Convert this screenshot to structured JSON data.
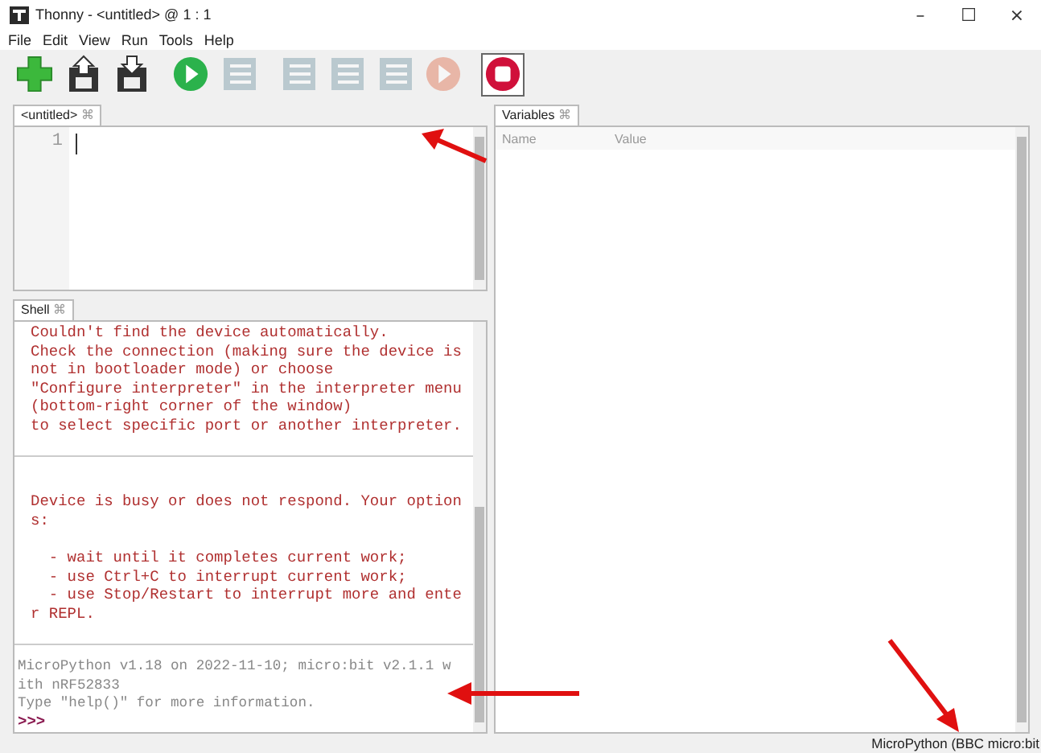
{
  "window": {
    "title": "Thonny  -  <untitled>  @  1 : 1",
    "controls": [
      "–",
      "☐",
      "×"
    ]
  },
  "menu": [
    "File",
    "Edit",
    "View",
    "Run",
    "Tools",
    "Help"
  ],
  "toolbar": [
    {
      "kind": "new",
      "disabled": false,
      "selected": false
    },
    {
      "kind": "load",
      "disabled": false,
      "selected": false
    },
    {
      "kind": "save",
      "disabled": false,
      "selected": false
    },
    {
      "kind": "run",
      "disabled": false,
      "selected": false
    },
    {
      "kind": "debug",
      "disabled": true,
      "selected": false
    },
    {
      "kind": "step-over",
      "disabled": true,
      "selected": false
    },
    {
      "kind": "step-into",
      "disabled": true,
      "selected": false
    },
    {
      "kind": "step-out",
      "disabled": true,
      "selected": false
    },
    {
      "kind": "resume",
      "disabled": true,
      "selected": false
    },
    {
      "kind": "stop",
      "disabled": false,
      "selected": true
    }
  ],
  "editor": {
    "tab": "<untitled>",
    "close": "⌘",
    "line_numbers": [
      "1"
    ]
  },
  "shell": {
    "tab": "Shell",
    "close": "⌘",
    "blocks": [
      {
        "kind": "error",
        "paragraphs": [
          [
            "Couldn't find the device automatically.",
            "Check the connection (making sure the device is",
            "not in bootloader mode) or choose",
            "\"Configure interpreter\" in the interpreter menu",
            "(bottom-right corner of the window)",
            "to select specific port or another interpreter."
          ]
        ]
      },
      {
        "kind": "error",
        "paragraphs": [
          [
            "Device is busy or does not respond. Your option",
            "s:"
          ],
          [
            "  - wait until it completes current work;",
            "  - use Ctrl+C to interrupt current work;",
            "  - use Stop/Restart to interrupt more and ente",
            "r REPL."
          ]
        ]
      },
      {
        "kind": "info",
        "paragraphs": [
          [
            "MicroPython v1.18 on 2022-11-10; micro:bit v2.1.1 w",
            "ith nRF52833",
            "Type \"help()\" for more information."
          ]
        ]
      }
    ],
    "prompt": ">>>"
  },
  "variables": {
    "tab": "Variables",
    "close": "⌘",
    "columns": [
      "Name",
      "Value"
    ]
  },
  "status_bar": {
    "interpreter": "MicroPython (BBC micro:bit"
  }
}
